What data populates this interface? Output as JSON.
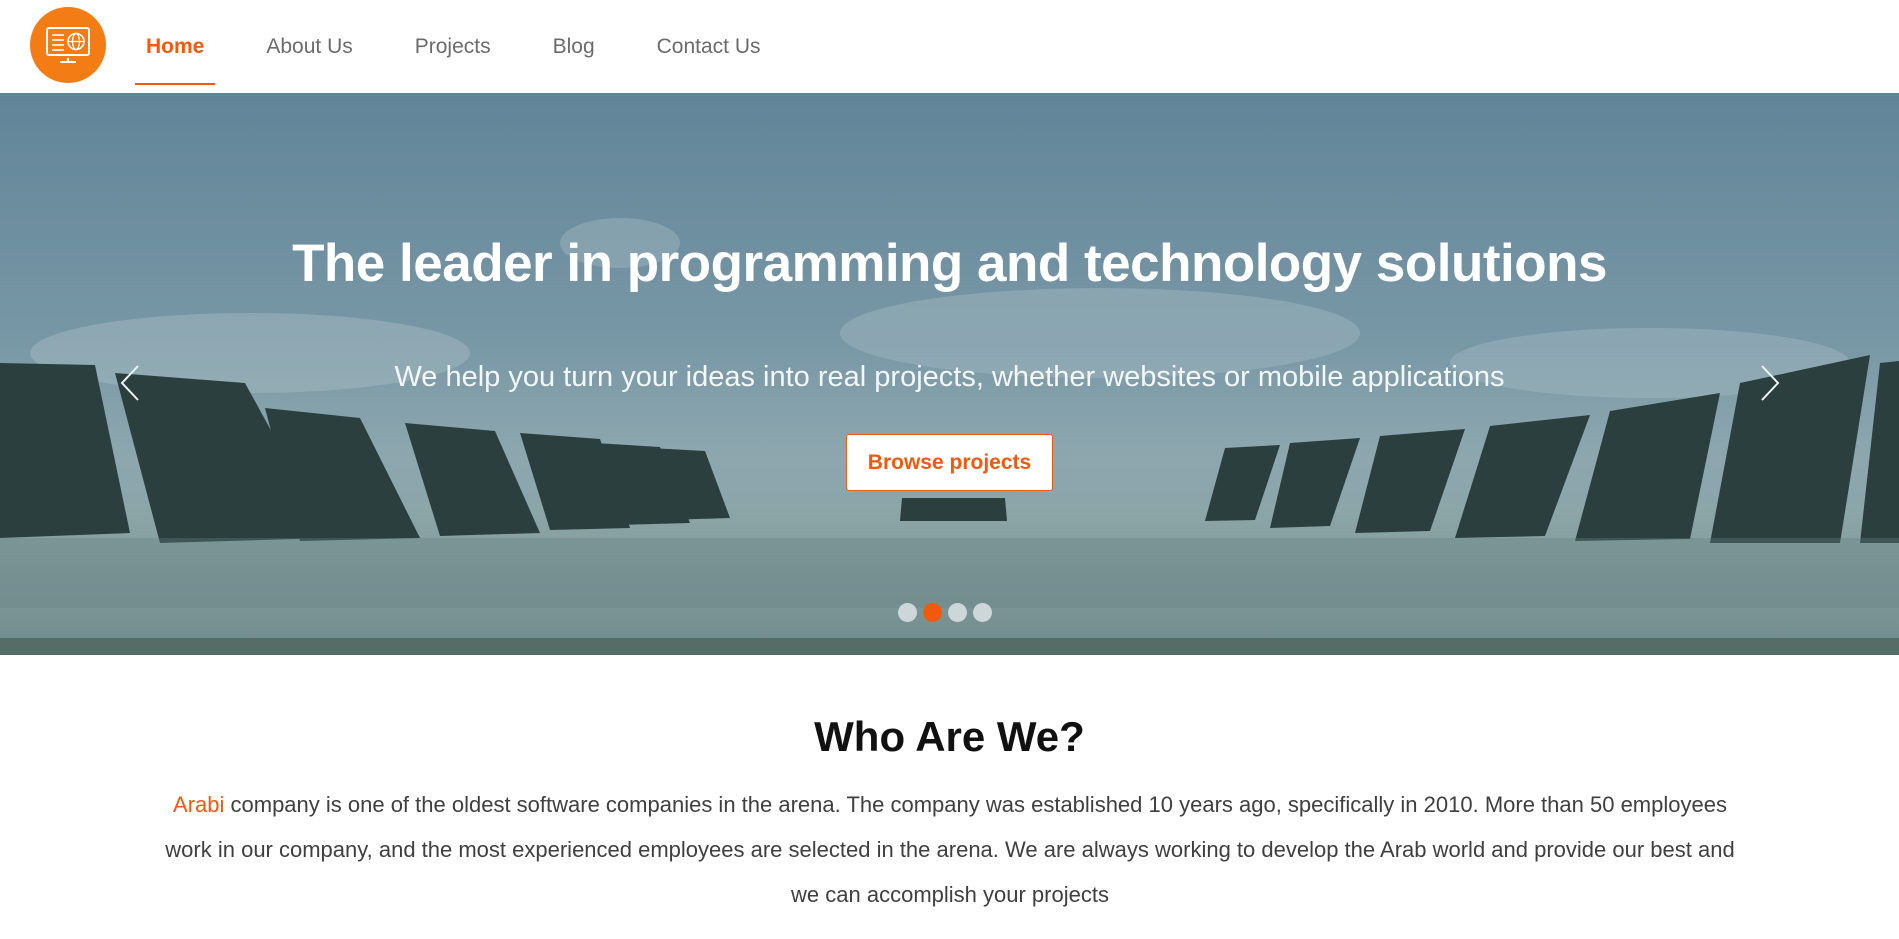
{
  "nav": {
    "logo_icon": "monitor-globe-icon",
    "items": [
      {
        "label": "Home",
        "active": true
      },
      {
        "label": "About Us"
      },
      {
        "label": "Projects"
      },
      {
        "label": "Blog"
      },
      {
        "label": "Contact Us"
      }
    ]
  },
  "hero": {
    "title": "The leader in programming and technology solutions",
    "subtitle": "We help you turn your ideas into real projects, whether websites or mobile applications",
    "button_label": "Browse projects",
    "prev_icon": "chevron-left-icon",
    "next_icon": "chevron-right-icon",
    "slide_count": 4,
    "active_slide": 2
  },
  "about": {
    "title": "Who Are We?",
    "brand": "Arabi",
    "text": " company is one of the oldest software companies in the arena. The company was established 10 years ago, specifically in 2010. More than 50 employees work in our company, and the most experienced employees are selected in the arena. We are always working to develop the Arab world and provide our best and we can accomplish your projects"
  },
  "colors": {
    "accent": "#f15a0e",
    "logo_bg": "#f47c15",
    "text_muted": "#6b6b6b",
    "body_text": "#3f3f3f"
  }
}
